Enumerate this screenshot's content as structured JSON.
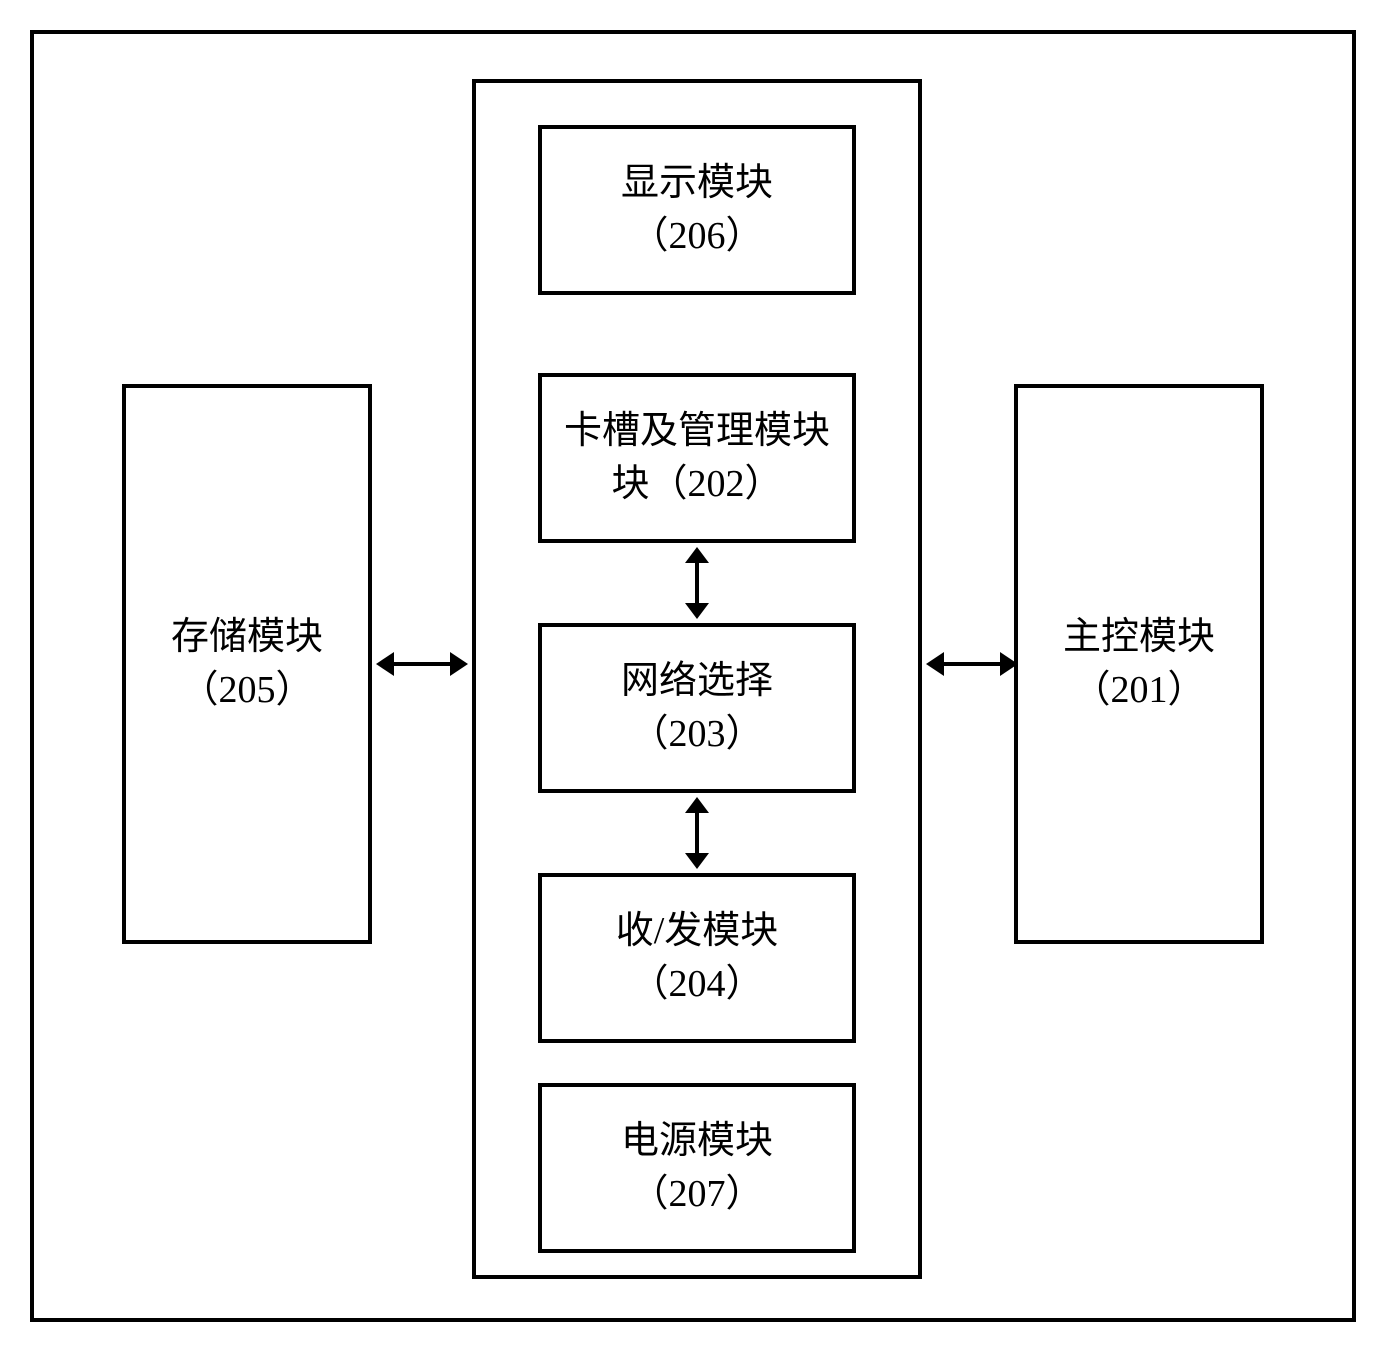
{
  "diagram": {
    "left": {
      "title": "存储模块",
      "code": "（205）"
    },
    "right": {
      "title": "主控模块",
      "code": "（201）"
    },
    "center": {
      "box206": {
        "title": "显示模块",
        "code": "（206）"
      },
      "box202": {
        "title": "卡槽及管理模块",
        "code_prefix": "块",
        "code": "（202）"
      },
      "box203": {
        "title": "网络选择",
        "code": "（203）"
      },
      "box204": {
        "title": "收/发模块",
        "code": "（204）"
      },
      "box207": {
        "title": "电源模块",
        "code": "（207）"
      }
    }
  }
}
